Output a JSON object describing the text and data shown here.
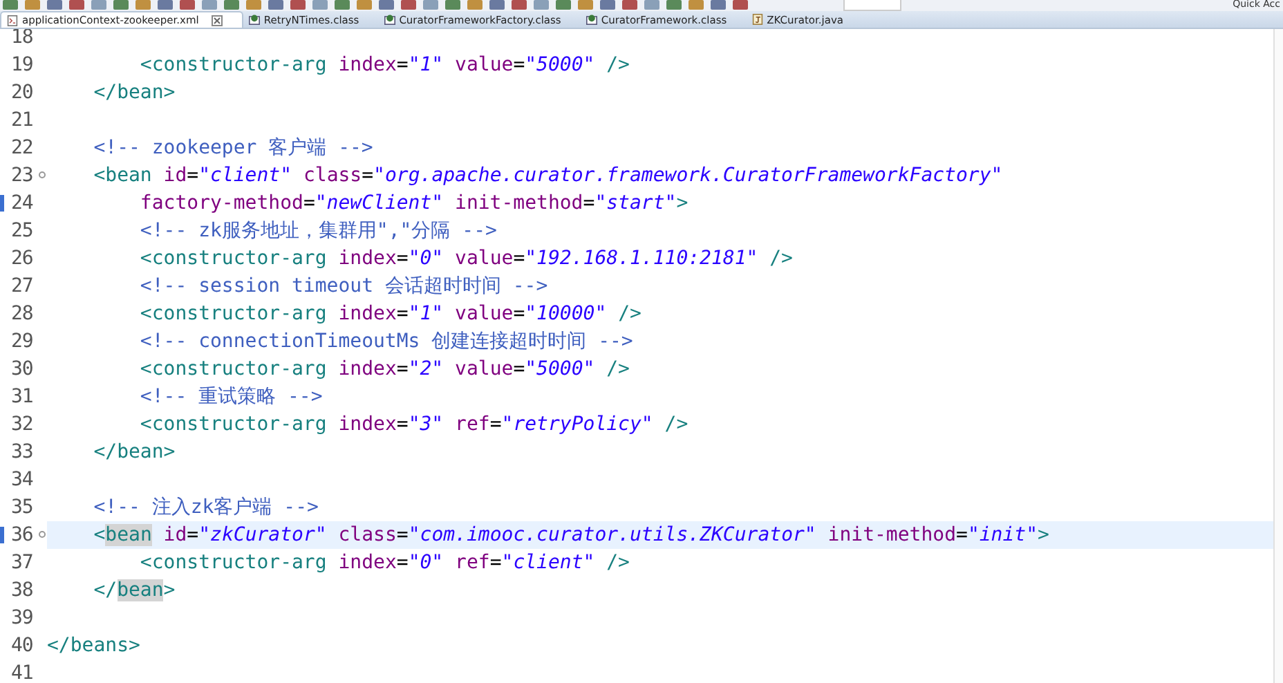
{
  "toolbar": {
    "quick_access": "Quick Acc"
  },
  "tabs": [
    {
      "label": "applicationContext-zookeeper.xml",
      "kind": "xml",
      "selected": true
    },
    {
      "label": "RetryNTimes.class",
      "kind": "class",
      "selected": false
    },
    {
      "label": "CuratorFrameworkFactory.class",
      "kind": "class",
      "selected": false
    },
    {
      "label": "CuratorFramework.class",
      "kind": "class",
      "selected": false
    },
    {
      "label": "ZKCurator.java",
      "kind": "java",
      "selected": false
    }
  ],
  "editor": {
    "lines": [
      {
        "number": "18",
        "current": false,
        "fold": false,
        "marker": false
      },
      {
        "number": "19",
        "current": false,
        "fold": false,
        "marker": false,
        "tokens": [
          {
            "kind": "tag",
            "text": "        <constructor-arg"
          },
          {
            "kind": "attr",
            "text": " index"
          },
          {
            "kind": "plain",
            "text": "="
          },
          {
            "kind": "value",
            "text": "\"1\""
          },
          {
            "kind": "attr",
            "text": " value"
          },
          {
            "kind": "plain",
            "text": "="
          },
          {
            "kind": "value",
            "text": "\"5000\""
          },
          {
            "kind": "tag",
            "text": " />"
          }
        ]
      },
      {
        "number": "20",
        "current": false,
        "fold": false,
        "marker": false,
        "tokens": [
          {
            "kind": "tag",
            "text": "    </bean>"
          }
        ]
      },
      {
        "number": "21",
        "current": false,
        "fold": false,
        "marker": false
      },
      {
        "number": "22",
        "current": false,
        "fold": false,
        "marker": false,
        "tokens": [
          {
            "kind": "comment",
            "text": "    <!-- zookeeper 客户端 -->"
          }
        ]
      },
      {
        "number": "23",
        "current": false,
        "fold": true,
        "marker": false,
        "tokens": [
          {
            "kind": "tag",
            "text": "    <bean"
          },
          {
            "kind": "attr",
            "text": " id"
          },
          {
            "kind": "plain",
            "text": "="
          },
          {
            "kind": "value",
            "text": "\"client\""
          },
          {
            "kind": "attr",
            "text": " class"
          },
          {
            "kind": "plain",
            "text": "="
          },
          {
            "kind": "value",
            "text": "\"org.apache.curator.framework.CuratorFrameworkFactory\""
          }
        ]
      },
      {
        "number": "24",
        "current": false,
        "fold": false,
        "marker": true,
        "tokens": [
          {
            "kind": "attr",
            "text": "        factory-method"
          },
          {
            "kind": "plain",
            "text": "="
          },
          {
            "kind": "value",
            "text": "\"newClient\""
          },
          {
            "kind": "attr",
            "text": " init-method"
          },
          {
            "kind": "plain",
            "text": "="
          },
          {
            "kind": "value",
            "text": "\"start\""
          },
          {
            "kind": "tag",
            "text": ">"
          }
        ]
      },
      {
        "number": "25",
        "current": false,
        "fold": false,
        "marker": false,
        "tokens": [
          {
            "kind": "comment",
            "text": "        <!-- zk服务地址，集群用\",\"分隔 -->"
          }
        ]
      },
      {
        "number": "26",
        "current": false,
        "fold": false,
        "marker": false,
        "tokens": [
          {
            "kind": "tag",
            "text": "        <constructor-arg"
          },
          {
            "kind": "attr",
            "text": " index"
          },
          {
            "kind": "plain",
            "text": "="
          },
          {
            "kind": "value",
            "text": "\"0\""
          },
          {
            "kind": "attr",
            "text": " value"
          },
          {
            "kind": "plain",
            "text": "="
          },
          {
            "kind": "value",
            "text": "\"192.168.1.110:2181\""
          },
          {
            "kind": "tag",
            "text": " />"
          }
        ]
      },
      {
        "number": "27",
        "current": false,
        "fold": false,
        "marker": false,
        "tokens": [
          {
            "kind": "comment",
            "text": "        <!-- session timeout 会话超时时间 -->"
          }
        ]
      },
      {
        "number": "28",
        "current": false,
        "fold": false,
        "marker": false,
        "tokens": [
          {
            "kind": "tag",
            "text": "        <constructor-arg"
          },
          {
            "kind": "attr",
            "text": " index"
          },
          {
            "kind": "plain",
            "text": "="
          },
          {
            "kind": "value",
            "text": "\"1\""
          },
          {
            "kind": "attr",
            "text": " value"
          },
          {
            "kind": "plain",
            "text": "="
          },
          {
            "kind": "value",
            "text": "\"10000\""
          },
          {
            "kind": "tag",
            "text": " />"
          }
        ]
      },
      {
        "number": "29",
        "current": false,
        "fold": false,
        "marker": false,
        "tokens": [
          {
            "kind": "comment",
            "text": "        <!-- connectionTimeoutMs 创建连接超时时间 -->"
          }
        ]
      },
      {
        "number": "30",
        "current": false,
        "fold": false,
        "marker": false,
        "tokens": [
          {
            "kind": "tag",
            "text": "        <constructor-arg"
          },
          {
            "kind": "attr",
            "text": " index"
          },
          {
            "kind": "plain",
            "text": "="
          },
          {
            "kind": "value",
            "text": "\"2\""
          },
          {
            "kind": "attr",
            "text": " value"
          },
          {
            "kind": "plain",
            "text": "="
          },
          {
            "kind": "value",
            "text": "\"5000\""
          },
          {
            "kind": "tag",
            "text": " />"
          }
        ]
      },
      {
        "number": "31",
        "current": false,
        "fold": false,
        "marker": false,
        "tokens": [
          {
            "kind": "comment",
            "text": "        <!-- 重试策略 -->"
          }
        ]
      },
      {
        "number": "32",
        "current": false,
        "fold": false,
        "marker": false,
        "tokens": [
          {
            "kind": "tag",
            "text": "        <constructor-arg"
          },
          {
            "kind": "attr",
            "text": " index"
          },
          {
            "kind": "plain",
            "text": "="
          },
          {
            "kind": "value",
            "text": "\"3\""
          },
          {
            "kind": "attr",
            "text": " ref"
          },
          {
            "kind": "plain",
            "text": "="
          },
          {
            "kind": "value",
            "text": "\"retryPolicy\""
          },
          {
            "kind": "tag",
            "text": " />"
          }
        ]
      },
      {
        "number": "33",
        "current": false,
        "fold": false,
        "marker": false,
        "tokens": [
          {
            "kind": "tag",
            "text": "    </bean>"
          }
        ]
      },
      {
        "number": "34",
        "current": false,
        "fold": false,
        "marker": false
      },
      {
        "number": "35",
        "current": false,
        "fold": false,
        "marker": false,
        "tokens": [
          {
            "kind": "comment",
            "text": "    <!-- 注入zk客户端 -->"
          }
        ]
      },
      {
        "number": "36",
        "current": true,
        "fold": true,
        "marker": true,
        "tokens": [
          {
            "kind": "tag",
            "text": "    <"
          },
          {
            "kind": "occurrence",
            "text": "bean"
          },
          {
            "kind": "attr",
            "text": " id"
          },
          {
            "kind": "plain",
            "text": "="
          },
          {
            "kind": "value",
            "text": "\"zkCurator\""
          },
          {
            "kind": "attr",
            "text": " class"
          },
          {
            "kind": "plain",
            "text": "="
          },
          {
            "kind": "value",
            "text": "\"com.imooc.curator.utils.ZKCurator\""
          },
          {
            "kind": "attr",
            "text": " init-method"
          },
          {
            "kind": "plain",
            "text": "="
          },
          {
            "kind": "value",
            "text": "\"init\""
          },
          {
            "kind": "tag",
            "text": ">"
          }
        ]
      },
      {
        "number": "37",
        "current": false,
        "fold": false,
        "marker": false,
        "tokens": [
          {
            "kind": "tag",
            "text": "        <constructor-arg"
          },
          {
            "kind": "attr",
            "text": " index"
          },
          {
            "kind": "plain",
            "text": "="
          },
          {
            "kind": "value",
            "text": "\"0\""
          },
          {
            "kind": "attr",
            "text": " ref"
          },
          {
            "kind": "plain",
            "text": "="
          },
          {
            "kind": "value",
            "text": "\"client\""
          },
          {
            "kind": "tag",
            "text": " />"
          }
        ]
      },
      {
        "number": "38",
        "current": false,
        "fold": false,
        "marker": false,
        "tokens": [
          {
            "kind": "tag",
            "text": "    </"
          },
          {
            "kind": "occurrence",
            "text": "bean"
          },
          {
            "kind": "tag",
            "text": ">"
          }
        ]
      },
      {
        "number": "39",
        "current": false,
        "fold": false,
        "marker": false
      },
      {
        "number": "40",
        "current": false,
        "fold": false,
        "marker": false,
        "tokens": [
          {
            "kind": "tag",
            "text": "</beans>"
          }
        ]
      },
      {
        "number": "41",
        "current": false,
        "fold": false,
        "marker": false
      }
    ]
  }
}
